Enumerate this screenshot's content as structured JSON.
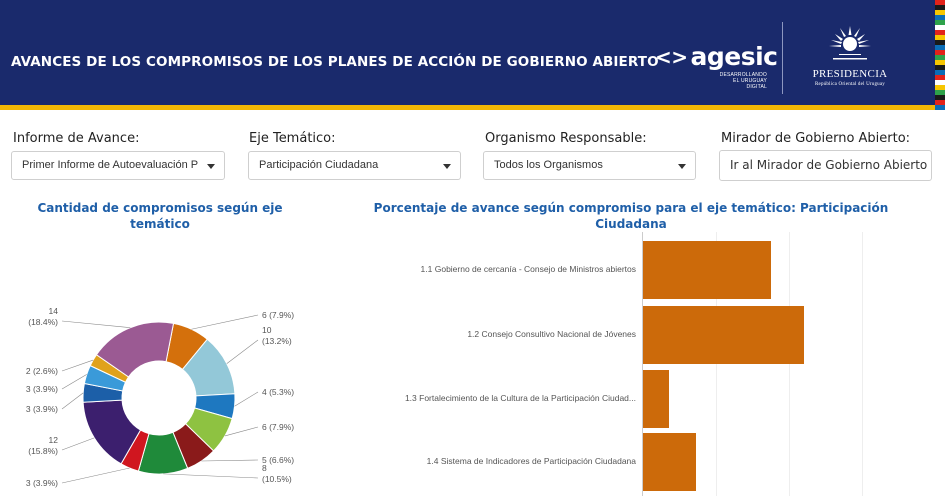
{
  "header": {
    "title": "AVANCES DE LOS COMPROMISOS DE LOS PLANES DE ACCIÓN DE GOBIERNO ABIERTO",
    "agesic_logo": {
      "word": "agesic",
      "tagline_1": "DESARROLLANDO",
      "tagline_2": "EL URUGUAY DIGITAL"
    },
    "presidencia_logo": {
      "word": "PRESIDENCIA",
      "tagline": "República Oriental del Uruguay"
    },
    "stripe_colors": [
      "#e2231a",
      "#1a1a1a",
      "#f7c600",
      "#0b6db7",
      "#2ea24a",
      "#ffffff",
      "#e2231a",
      "#f7c600",
      "#1a1a1a",
      "#0b6db7",
      "#e2231a",
      "#2ea24a",
      "#f7c600",
      "#1a1a1a",
      "#0b6db7",
      "#e2231a",
      "#ffffff",
      "#f7c600",
      "#2ea24a",
      "#1a1a1a",
      "#e2231a",
      "#0b6db7"
    ]
  },
  "filters": {
    "informe": {
      "label": "Informe de Avance:",
      "value": "Primer Informe de Autoevaluación P"
    },
    "eje": {
      "label": "Eje Temático:",
      "value": "Participación Ciudadana"
    },
    "organismo": {
      "label": "Organismo Responsable:",
      "value": "Todos los Organismos"
    },
    "mirador": {
      "label": "Mirador de Gobierno Abierto:",
      "button": "Ir al Mirador de Gobierno Abierto"
    }
  },
  "chart_data": [
    {
      "type": "pie",
      "title": "Cantidad de compromisos según eje temático",
      "donut": true,
      "slices": [
        {
          "value": 6,
          "label": "6 (7.9%)",
          "color": "#d4700c"
        },
        {
          "value": 10,
          "label": "10\n(13.2%)",
          "color": "#93c8d8"
        },
        {
          "value": 4,
          "label": "4 (5.3%)",
          "color": "#1e78c0"
        },
        {
          "value": 6,
          "label": "6 (7.9%)",
          "color": "#8ec241"
        },
        {
          "value": 5,
          "label": "5 (6.6%)",
          "color": "#8a1a1a"
        },
        {
          "value": 8,
          "label": "8\n(10.5%)",
          "color": "#1f8a3a"
        },
        {
          "value": 3,
          "label": "3 (3.9%)",
          "color": "#d0161f"
        },
        {
          "value": 12,
          "label": "12\n(15.8%)",
          "color": "#3c1f6e"
        },
        {
          "value": 3,
          "label": "3 (3.9%)",
          "color": "#1c5fa8"
        },
        {
          "value": 3,
          "label": "3 (3.9%)",
          "color": "#3a9ad9"
        },
        {
          "value": 2,
          "label": "2 (2.6%)",
          "color": "#e0a21c"
        },
        {
          "value": 14,
          "label": "14\n(18.4%)",
          "color": "#9b5a93"
        }
      ]
    },
    {
      "type": "bar",
      "orientation": "horizontal",
      "title": "Porcentaje de avance según compromiso para el eje temático: Participación Ciudadana",
      "categories": [
        "1.1 Gobierno de cercanía - Consejo de Ministros abiertos",
        "1.2 Consejo Consultivo Nacional de Jóvenes",
        "1.3 Fortalecimiento de la Cultura de la Participación Ciudad...",
        "1.4 Sistema de Indicadores de Participación Ciudadana"
      ],
      "values": [
        44,
        55,
        9,
        18
      ],
      "xlim": [
        0,
        100
      ],
      "color": "#cc6a0a"
    }
  ]
}
